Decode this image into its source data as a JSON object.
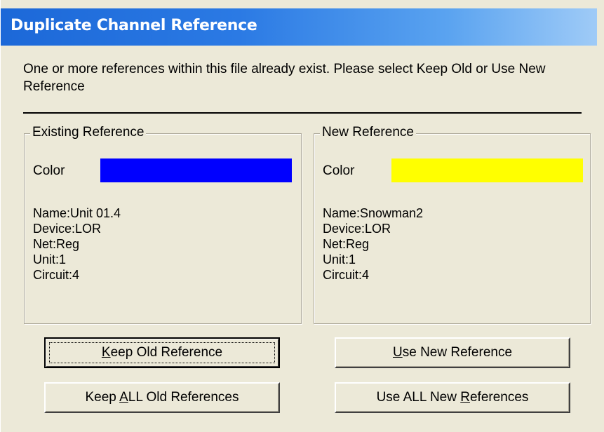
{
  "title": "Duplicate Channel Reference",
  "message": "One or more references within this file already exist.  Please select Keep Old or Use New Reference",
  "existing": {
    "legend": "Existing Reference",
    "color_label": "Color",
    "color": "#0000ff",
    "lines": [
      "Name:Unit 01.4",
      "Device:LOR",
      "Net:Reg",
      "Unit:1",
      "Circuit:4"
    ]
  },
  "new": {
    "legend": "New Reference",
    "color_label": "Color",
    "color": "#ffff00",
    "lines": [
      "Name:Snowman2",
      "Device:LOR",
      "Net:Reg",
      "Unit:1",
      "Circuit:4"
    ]
  },
  "buttons": {
    "keep_old": {
      "before": "",
      "mnemonic": "K",
      "after": "eep Old Reference"
    },
    "use_new": {
      "before": "",
      "mnemonic": "U",
      "after": "se New Reference"
    },
    "keep_all_old": {
      "before": "Keep ",
      "mnemonic": "A",
      "after": "LL Old References"
    },
    "use_all_new": {
      "before": "Use ALL New ",
      "mnemonic": "R",
      "after": "eferences"
    }
  }
}
